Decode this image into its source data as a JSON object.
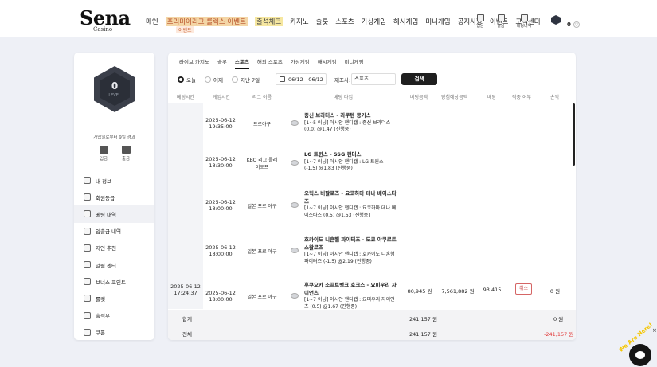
{
  "header": {
    "logo": "Sena",
    "logo_sub": "Casino",
    "nav": [
      "메인",
      "프리미어리그 롤렉스 이벤트",
      "출석체크",
      "카지노",
      "슬롯",
      "스포츠",
      "가상게임",
      "해시게임",
      "미니게임",
      "공지사항",
      "이벤트",
      "고객센터"
    ],
    "nav_badge": "이벤트",
    "icons": [
      {
        "name": "deposit-icon",
        "label": "입금"
      },
      {
        "name": "withdraw-icon",
        "label": "출금"
      },
      {
        "name": "bet-history-icon",
        "label": "베팅내역"
      }
    ],
    "money": "0"
  },
  "sidebar": {
    "level_num": "0",
    "level_label": "LEVEL",
    "join_info": "가입일로부터 9일 경과",
    "btn_deposit": "입금",
    "btn_withdraw": "출금",
    "menu": [
      "내 정보",
      "회원등급",
      "베팅 내역",
      "입출금 내역",
      "지인 추천",
      "알림 센터",
      "보너스 포인트",
      "룰렛",
      "출석부",
      "쿠폰"
    ]
  },
  "tabs": [
    "라이브 카지노",
    "슬롯",
    "스포츠",
    "해외 스포츠",
    "가상게임",
    "해시게임",
    "미니게임"
  ],
  "filter": {
    "today": "오늘",
    "yesterday": "어제",
    "last7": "지난 7일",
    "date_range": "06/12 - 06/12",
    "title_label": "제조사:",
    "title_value": "스포츠",
    "search": "검색"
  },
  "columns": [
    "베팅시간",
    "게임시간",
    "리그 이름",
    "베팅 타입",
    "베팅금액",
    "당첨예상금액",
    "배당",
    "적중 여부",
    "손익"
  ],
  "bet_time": [
    "2025-06-12",
    "17:24:37"
  ],
  "rows": [
    {
      "date": "2025-06-12",
      "time": "19:35:00",
      "league": "프로야구",
      "title": "중신 브라더스 - 라쿠텐 몽키스",
      "line1": "[1~5 이닝] 아시안 핸디캡 : 중신 브라더스",
      "line2": "(0.0) @1.47 (진행중)",
      "line3": ""
    },
    {
      "date": "2025-06-12",
      "time": "18:30:00",
      "league": "KBO 리그 플레이오프",
      "title": "LG 트윈스 - SSG 랜더스",
      "line1": "[1~7 이닝] 아시안 핸디캡 : LG 트윈스",
      "line2": "(-1.5) @1.83 (진행중)",
      "line3": ""
    },
    {
      "date": "2025-06-12",
      "time": "18:00:00",
      "league": "일본 프로 야구",
      "title": "오릭스 버팔로즈 - 요코하마 데나 베이스타즈",
      "line1": "[1~7 이닝] 아시안 핸디캡 : 요코하마 데나 베",
      "line2": "이스타즈 (0.5) @1.53 (진행중)",
      "line3": ""
    },
    {
      "date": "2025-06-12",
      "time": "18:00:00",
      "league": "일본 프로 야구",
      "title": "호카이도 니혼햄 파이터즈 - 도쿄 야쿠르트 스왈로즈",
      "line1": "[1~7 이닝] 아시안 핸디캡 : 호카이도 니혼햄",
      "line2": "파이터즈 (-1.5) @2.19 (진행중)",
      "line3": ""
    },
    {
      "date": "2025-06-12",
      "time": "18:00:00",
      "league": "일본 프로 야구",
      "title": "후쿠오카 소프트뱅크 호크스 - 요미우리 자이언츠",
      "line1": "[1~7 이닝] 아시안 핸디캡 : 요미우리 자이언",
      "line2": "츠 (0.5) @1.67 (진행중)",
      "line3": ""
    }
  ],
  "summary": {
    "bet_amount": "80,945 원",
    "expected_win": "7,561,882 원",
    "odds": "93.415",
    "cancel": "취소",
    "profit": "0 원"
  },
  "totals": [
    {
      "label": "합계",
      "bet": "241,157 원",
      "profit": "0 원"
    },
    {
      "label": "전체",
      "bet": "241,157 원",
      "profit": "-241,157 원"
    }
  ],
  "colors": {
    "negative": "#e23b3b",
    "cancel": "#c64a4a"
  },
  "chat": {
    "badge": "We Are Here!",
    "close": "×"
  }
}
